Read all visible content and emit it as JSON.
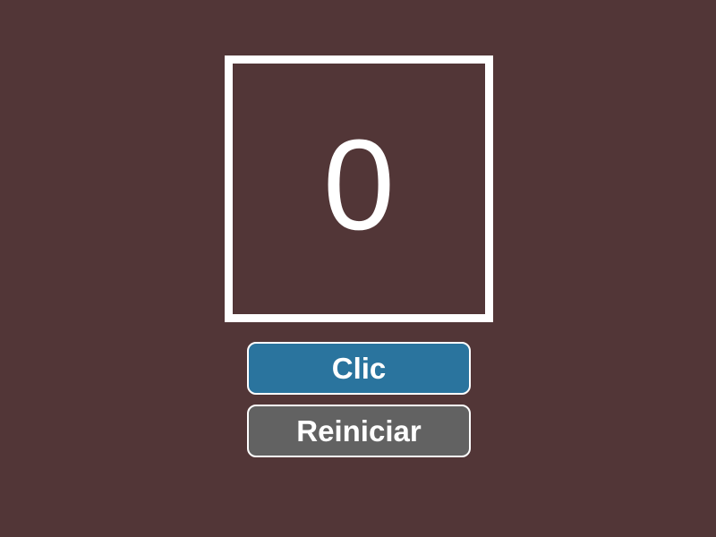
{
  "counter": {
    "value": "0"
  },
  "buttons": {
    "click_label": "Clic",
    "reset_label": "Reiniciar"
  },
  "colors": {
    "background": "#523637",
    "frame": "#ffffff",
    "click_button": "#2a749e",
    "reset_button": "#626262"
  }
}
